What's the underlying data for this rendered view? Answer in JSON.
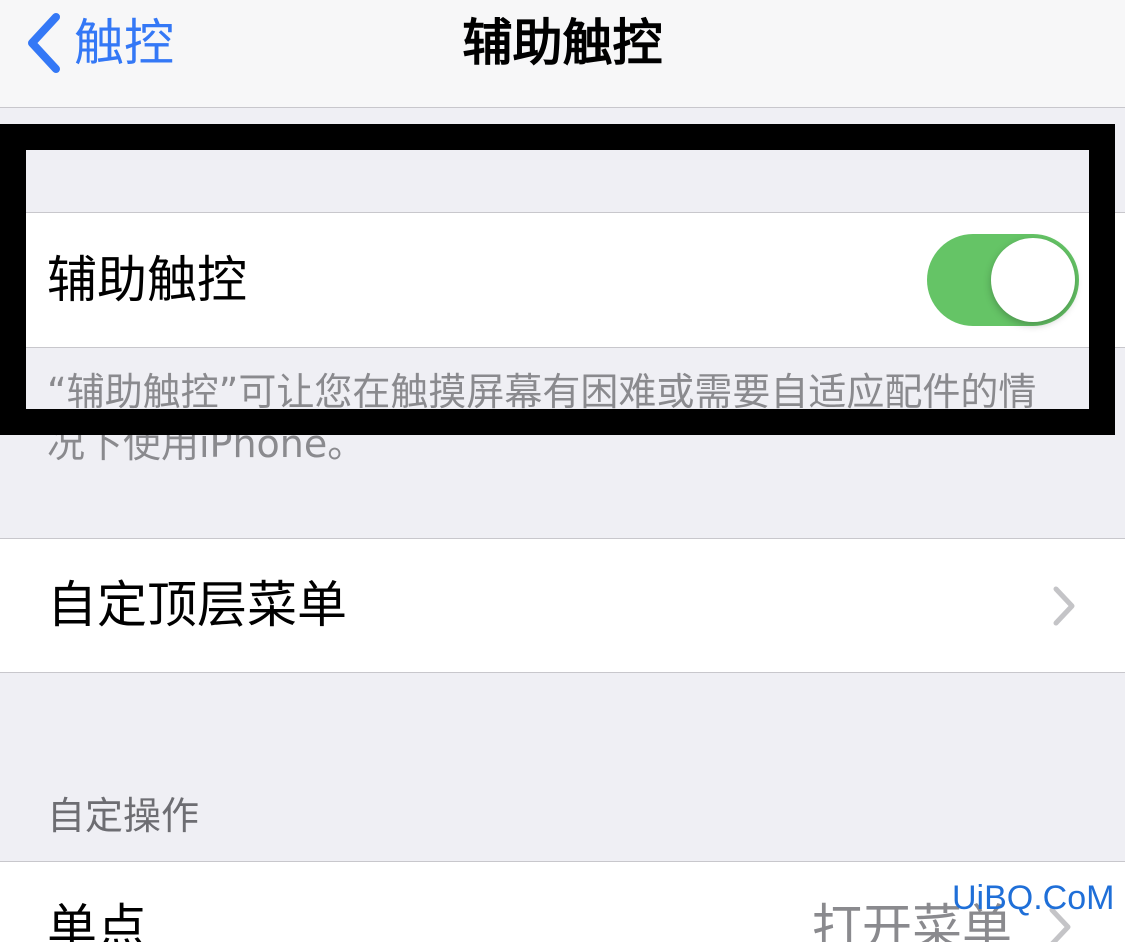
{
  "nav": {
    "back_label": "触控",
    "title": "辅助触控"
  },
  "toggle": {
    "label": "辅助触控",
    "on": true,
    "color": "#65c466"
  },
  "description": "“辅助触控”可让您在触摸屏幕有困难或需要自适应配件的情况下使用iPhone。",
  "menu_row": {
    "label": "自定顶层菜单"
  },
  "custom_actions": {
    "header": "自定操作",
    "single_tap": {
      "label": "单点",
      "value": "打开菜单"
    }
  },
  "watermark": "UiBQ.CoM",
  "colors": {
    "accent": "#3478f6",
    "background": "#efeff4"
  }
}
